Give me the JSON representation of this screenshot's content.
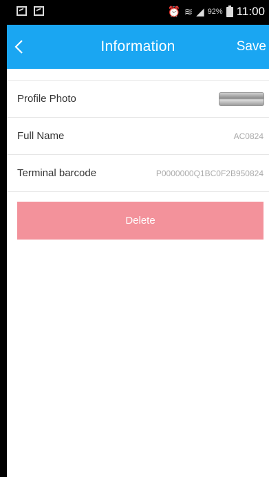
{
  "status_bar": {
    "battery_percent": "92%",
    "time": "11:00"
  },
  "header": {
    "title": "Information",
    "save_label": "Save"
  },
  "rows": [
    {
      "label": "Profile Photo",
      "value": ""
    },
    {
      "label": "Full Name",
      "value": "AC0824"
    },
    {
      "label": "Terminal barcode",
      "value": "P0000000Q1BC0F2B950824"
    }
  ],
  "delete_label": "Delete",
  "colors": {
    "header": "#1aa6f2",
    "delete_button": "#f3929b"
  }
}
